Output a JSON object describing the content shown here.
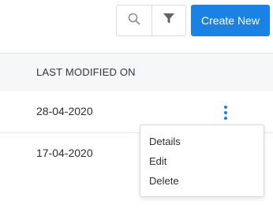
{
  "toolbar": {
    "search_icon": "search-icon",
    "filter_icon": "filter-icon",
    "create_label": "Create New"
  },
  "table": {
    "columns": [
      "LAST MODIFIED ON"
    ],
    "rows": [
      {
        "last_modified_on": "28-04-2020"
      },
      {
        "last_modified_on": "17-04-2020"
      }
    ]
  },
  "row_menu": {
    "icon": "more-vertical-icon",
    "items": [
      "Details",
      "Edit",
      "Delete"
    ]
  },
  "colors": {
    "accent": "#1a82e2",
    "header_bg": "#f6f7f9",
    "border": "#d9dce1"
  }
}
